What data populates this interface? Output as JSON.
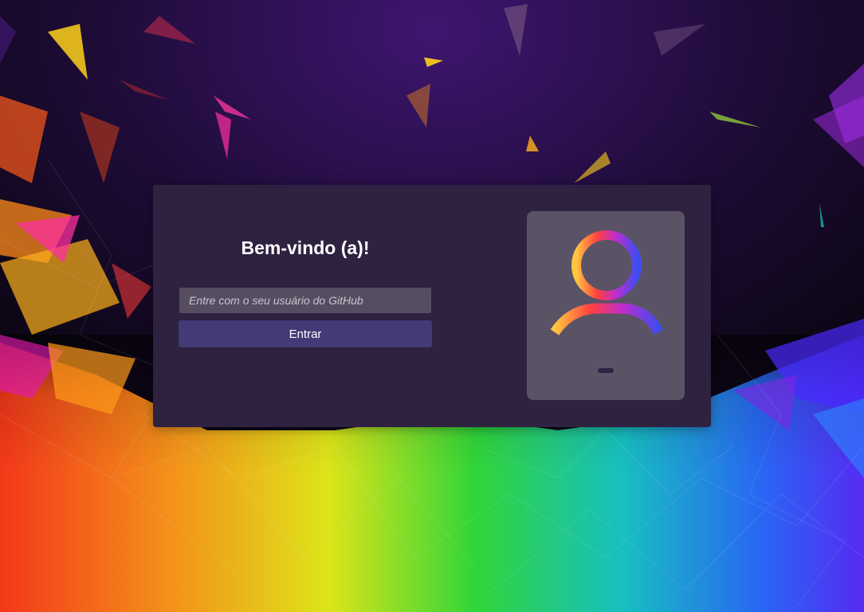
{
  "login": {
    "title": "Bem-vindo (a)!",
    "username_placeholder": "Entre com o seu usuário do GitHub",
    "username_value": "",
    "submit_label": "Entrar"
  },
  "avatar": {
    "icon": "user-avatar-icon"
  },
  "colors": {
    "background": "#14081f",
    "card": "#2f2140",
    "input": "#564d61",
    "button": "#433a76",
    "avatar_panel": "#5a5366",
    "gradient": [
      "#ffc640",
      "#ff4040",
      "#c02ccd",
      "#3f4cf0"
    ]
  }
}
